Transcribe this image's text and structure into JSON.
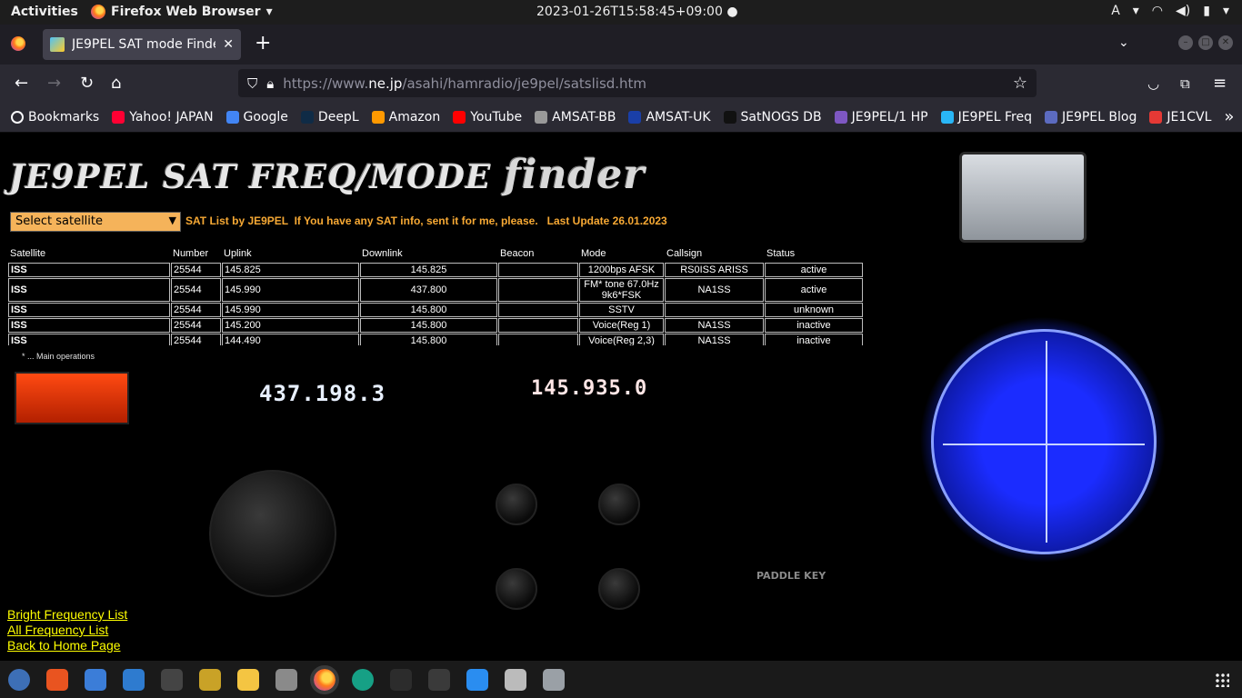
{
  "system": {
    "activities": "Activities",
    "app_name": "Firefox Web Browser",
    "datetime": "2023-01-26T15:58:45+09:00",
    "input_method": "A"
  },
  "browser": {
    "tab_title": "JE9PEL SAT mode Finder",
    "url_prefix": "https://www.",
    "url_domain": "ne.jp",
    "url_path": "/asahi/hamradio/je9pel/satslisd.htm",
    "bookmarks": [
      {
        "label": "Bookmarks",
        "color": "#fbfbfe"
      },
      {
        "label": "Yahoo! JAPAN",
        "color": "#ff0033"
      },
      {
        "label": "Google",
        "color": "#4285f4"
      },
      {
        "label": "DeepL",
        "color": "#0f2b46"
      },
      {
        "label": "Amazon",
        "color": "#ff9900"
      },
      {
        "label": "YouTube",
        "color": "#ff0000"
      },
      {
        "label": "AMSAT-BB",
        "color": "#999999"
      },
      {
        "label": "AMSAT-UK",
        "color": "#1a3fa8"
      },
      {
        "label": "SatNOGS DB",
        "color": "#111111"
      },
      {
        "label": "JE9PEL/1 HP",
        "color": "#7e57c2"
      },
      {
        "label": "JE9PEL Freq",
        "color": "#29b6f6"
      },
      {
        "label": "JE9PEL Blog",
        "color": "#5c6bc0"
      },
      {
        "label": "JE1CVL",
        "color": "#e53935"
      }
    ]
  },
  "page": {
    "title_main": "JE9PEL SAT FREQ/MODE",
    "title_script": "finder",
    "select_placeholder": "Select satellite",
    "info_line": "SAT List by JE9PEL  If You have any SAT info, sent it for me, please.   Last Update 26.01.2023",
    "table": {
      "headers": [
        "Satellite",
        "Number",
        "Uplink",
        "Downlink",
        "Beacon",
        "Mode",
        "Callsign",
        "Status"
      ],
      "rows": [
        {
          "satellite": "ISS",
          "number": "25544",
          "uplink": "145.825",
          "downlink": "145.825",
          "beacon": "",
          "mode": "1200bps AFSK",
          "callsign": "RS0ISS ARISS",
          "status": "active"
        },
        {
          "satellite": "ISS",
          "number": "25544",
          "uplink": "145.990",
          "downlink": "437.800",
          "beacon": "",
          "mode": "FM* tone 67.0Hz 9k6*FSK",
          "callsign": "NA1SS",
          "status": "active"
        },
        {
          "satellite": "ISS",
          "number": "25544",
          "uplink": "145.990",
          "downlink": "145.800",
          "beacon": "",
          "mode": "SSTV",
          "callsign": "",
          "status": "unknown"
        },
        {
          "satellite": "ISS",
          "number": "25544",
          "uplink": "145.200",
          "downlink": "145.800",
          "beacon": "",
          "mode": "Voice(Reg 1)",
          "callsign": "NA1SS",
          "status": "inactive"
        },
        {
          "satellite": "ISS",
          "number": "25544",
          "uplink": "144.490",
          "downlink": "145.800",
          "beacon": "",
          "mode": "Voice(Reg 2,3)",
          "callsign": "NA1SS",
          "status": "inactive"
        }
      ]
    },
    "footnote": "* ... Main operations",
    "radio": {
      "display_sub": "437.198.3",
      "display_main": "145.935.0",
      "label_paddle": "PADDLE KEY"
    },
    "links": {
      "bright": "Bright Frequency List",
      "all": "All Frequency List",
      "home": "Back to Home Page"
    }
  },
  "dock": {
    "icons": [
      "help-icon",
      "software-icon",
      "notes-icon",
      "thunderbird-icon",
      "headset-icon",
      "wand-icon",
      "text-editor-icon",
      "files-icon",
      "firefox-icon",
      "satellite-tracker-icon",
      "terminal-icon",
      "system-monitor-icon",
      "map-icon",
      "settings-icon",
      "satellite-dish-icon"
    ]
  }
}
